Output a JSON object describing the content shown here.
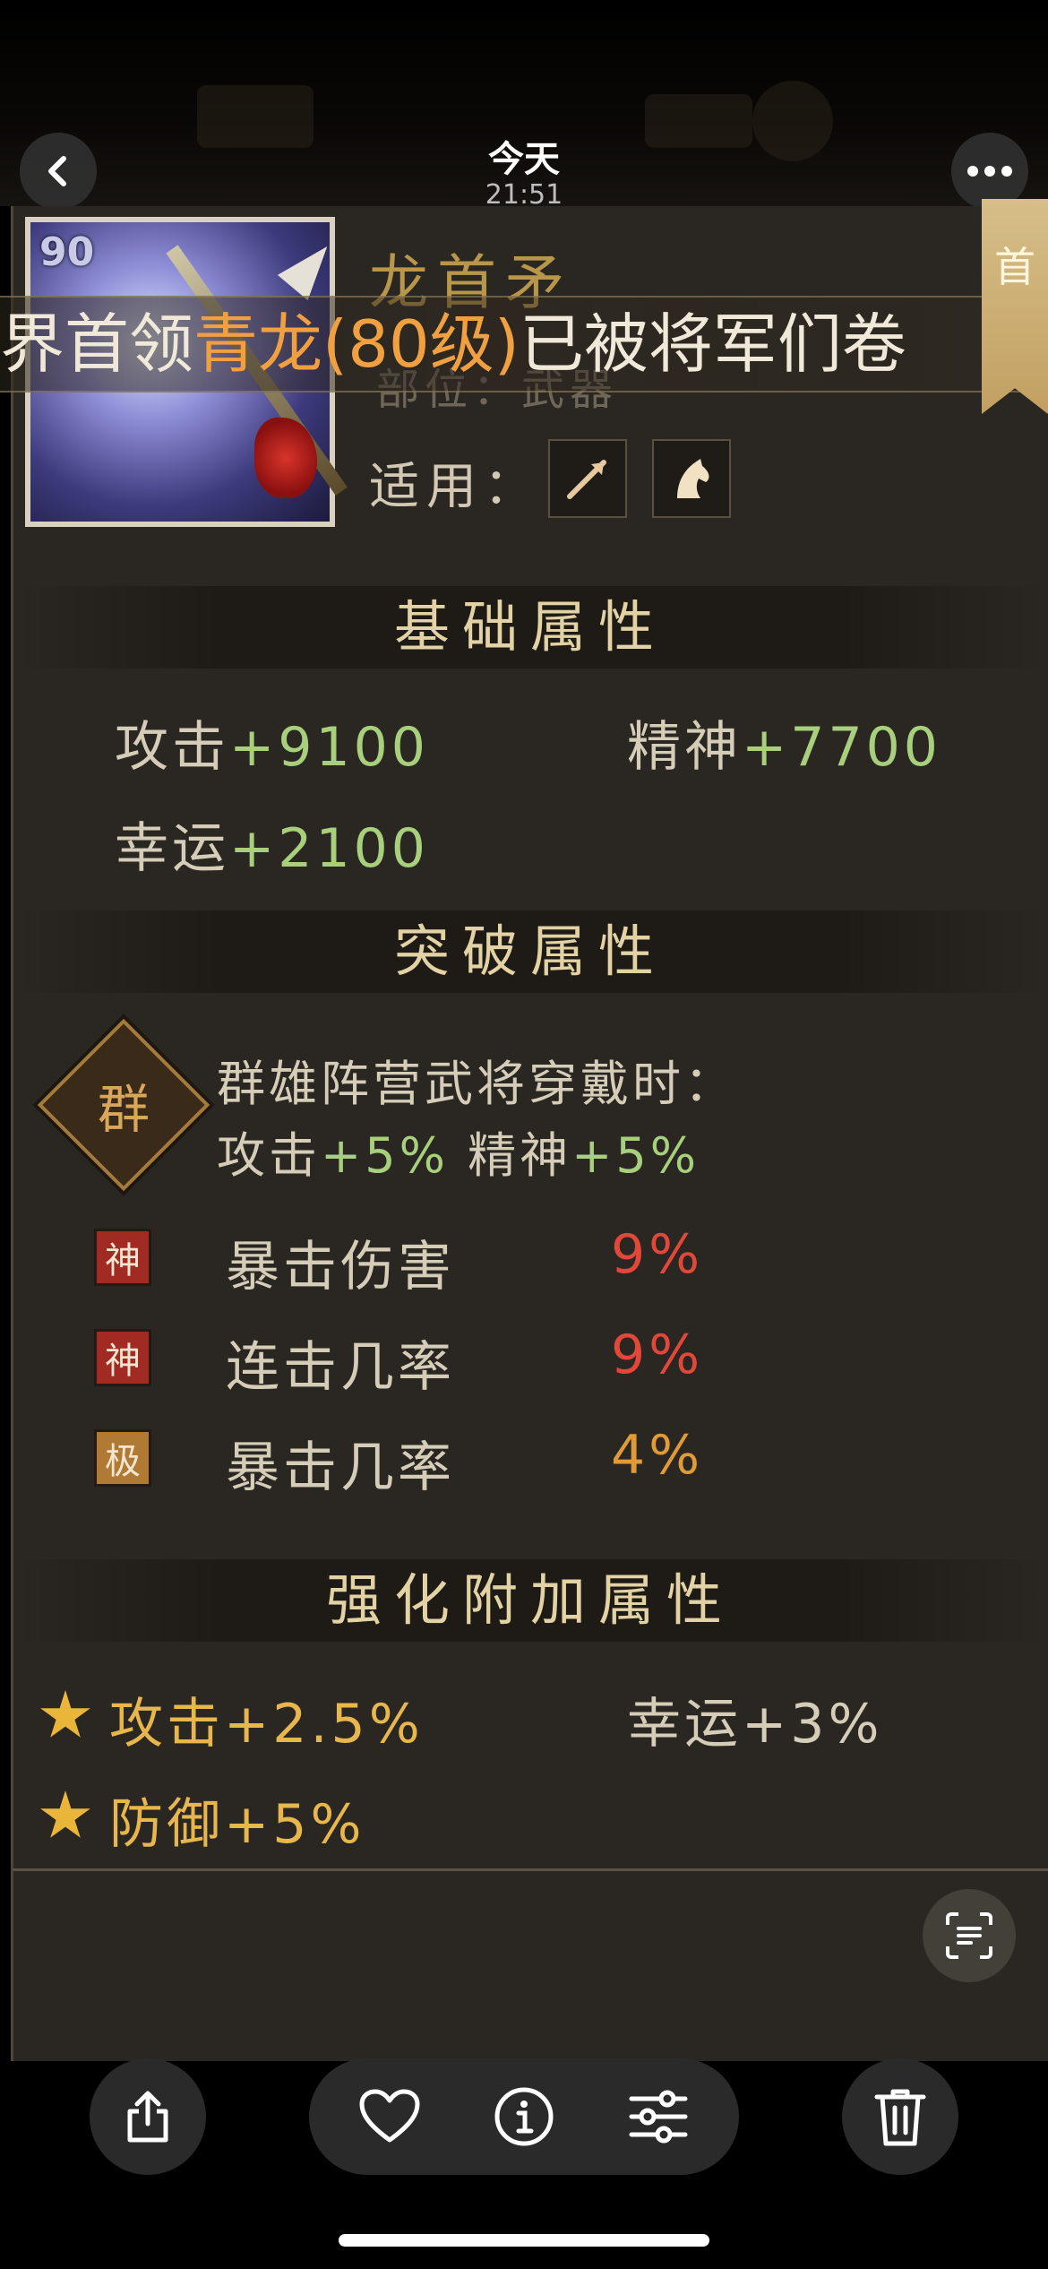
{
  "viewer": {
    "title": "今天",
    "time": "21:51"
  },
  "item": {
    "level": "90",
    "name": "龙首矛",
    "type": "部位：武器",
    "suits_label": "适用：",
    "suit_icons": [
      "bow-arrow-icon",
      "horse-icon"
    ]
  },
  "banner": {
    "prefix": "界首领",
    "highlight": "青龙(80级)",
    "suffix": "已被将军们卷",
    "corner_text": "首"
  },
  "basic": {
    "title": "基础属性",
    "stats": [
      {
        "label": "攻击",
        "value": "+9100"
      },
      {
        "label": "精神",
        "value": "+7700"
      },
      {
        "label": "幸运",
        "value": "+2100"
      }
    ]
  },
  "breakthrough": {
    "title": "突破属性",
    "faction_char": "群",
    "condition": "群雄阵营武将穿戴时：",
    "bonus": [
      {
        "label": "攻击",
        "value": "+5%"
      },
      {
        "label": "精神",
        "value": "+5%"
      }
    ],
    "rows": [
      {
        "tag": "神",
        "label": "暴击伤害",
        "value": "9%"
      },
      {
        "tag": "神",
        "label": "连击几率",
        "value": "9%"
      },
      {
        "tag": "极",
        "label": "暴击几率",
        "value": "4%"
      }
    ]
  },
  "enhance": {
    "title": "强化附加属性",
    "stats": [
      {
        "label": "攻击",
        "value": "+2.5%"
      },
      {
        "label": "幸运",
        "value": "+3%"
      },
      {
        "label": "防御",
        "value": "+5%"
      }
    ]
  },
  "colors": {
    "green_value": "#a7cf7c",
    "gold_value": "#e7b74d",
    "red_value": "#e2483a",
    "orange_value": "#e09a38"
  },
  "toolbar": {
    "icons": [
      "share-icon",
      "heart-icon",
      "info-icon",
      "adjust-icon",
      "trash-icon"
    ]
  }
}
